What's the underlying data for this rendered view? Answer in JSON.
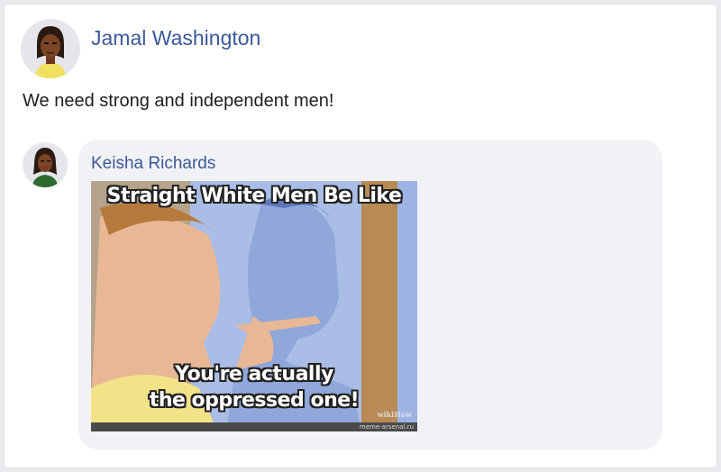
{
  "post": {
    "author": "Jamal Washington",
    "text": "We need strong and independent men!"
  },
  "comment": {
    "author": "Keisha Richards",
    "meme": {
      "top_text": "Straight White Men Be Like",
      "bottom_text_line1": "You're actually",
      "bottom_text_line2": "the oppressed one!",
      "watermark": "wikiHow",
      "footer": "meme-arsenal.ru"
    }
  },
  "colors": {
    "name_link": "#3b5998",
    "bubble": "#f0f2f5",
    "background": "#e9ebee"
  }
}
